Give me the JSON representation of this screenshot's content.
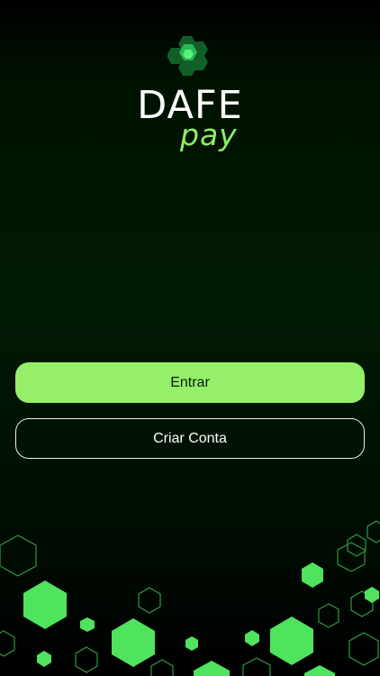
{
  "brand": {
    "name": "DAFE",
    "sub": "pay",
    "logo_icon": "hexagon-cluster-icon",
    "accent_color": "#95ef6a",
    "sub_color": "#8ef064"
  },
  "actions": {
    "login_label": "Entrar",
    "create_account_label": "Criar Conta"
  },
  "decoration": {
    "pattern_icon": "hexagon-pattern",
    "fill_color": "#4fe35e",
    "outline_color": "#2f9a3e"
  }
}
